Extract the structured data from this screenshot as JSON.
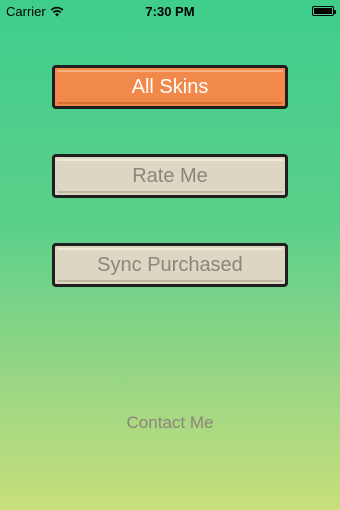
{
  "status_bar": {
    "carrier": "Carrier",
    "time": "7:30 PM",
    "wifi_icon": "wifi-icon",
    "battery_icon": "battery-icon"
  },
  "buttons": {
    "all_skins": "All Skins",
    "rate_me": "Rate Me",
    "sync_purchased": "Sync Purchased"
  },
  "contact": {
    "label": "Contact Me"
  },
  "colors": {
    "primary_button": "#f1894a",
    "secondary_button": "#dcd6c2",
    "secondary_text": "#8d857c",
    "background_top": "#3fcd8c",
    "background_bottom": "#c9df7c"
  }
}
